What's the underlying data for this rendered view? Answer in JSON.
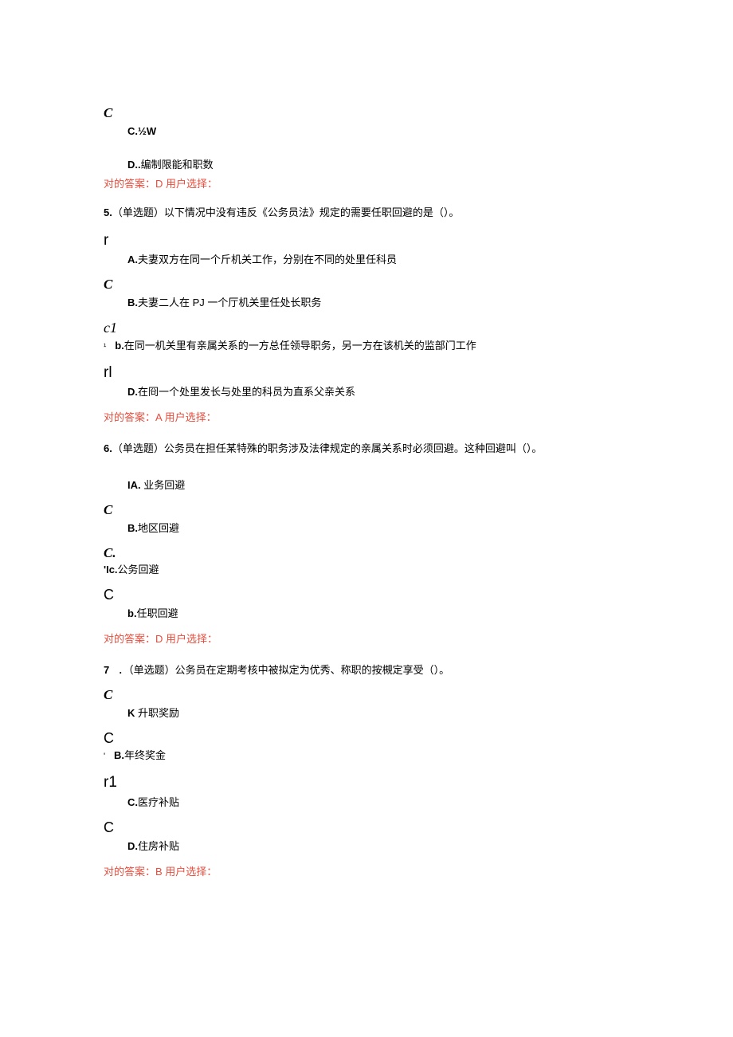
{
  "q4": {
    "markerC": "C",
    "optC_label": "C.",
    "optC_text": "½W",
    "optD_label": "D..",
    "optD_text": "编制限能和职数",
    "answer": "对的答案：D 用户选择："
  },
  "q5": {
    "number": "5.",
    "stem": "（单选题）以下情况中没有违反《公务员法》规定的需要任职回避的是（）。",
    "markerR": "r",
    "optA_label": "A.",
    "optA_text": "夫妻双方在同一个斤机关工作，分别在不同的处里任科员",
    "markerC": "C",
    "optB_label": "B.",
    "optB_text": "夫妻二人在 PJ 一个厅机关里任处长职务",
    "markerC1": "c1",
    "sub1": "¹",
    "optC_label": "b.",
    "optC_text": "在同一机关里有亲属关系的一方总任领导职务，另一方在该机关的监部门工作",
    "markerRl": "rl",
    "optD_label": "D.",
    "optD_text": "在冏一个处里发长与处里的科员为直系父亲关系",
    "answer": "对的答案：A 用户选择："
  },
  "q6": {
    "number": "6.",
    "stem": "（单选题）公务员在担任某特殊的职务涉及法律规定的亲属关系时必须回避。这种回避叫（）。",
    "optA_label": "IA.",
    "optA_text": " 业务回避",
    "markerC1": "C",
    "optB_label": "B.",
    "optB_text": "地区回避",
    "markerC2": "C.",
    "optC_label": "'Ic.",
    "optC_text": "公务回避",
    "markerC3": "C",
    "optD_label": "b.",
    "optD_text": "任职回避",
    "answer": "对的答案：D 用户选择："
  },
  "q7": {
    "number": "7",
    "stem": "．（单选题）公务员在定期考核中被拟定为优秀、称职的按槻定享受（）。",
    "markerC1": "C",
    "optA_label": "K",
    "optA_text": " 升职奖励",
    "markerC2": "C",
    "sub2": "'",
    "optB_label": "B.",
    "optB_text": "年终奖金",
    "markerR1": "r1",
    "optC_label": "C.",
    "optC_text": "医疗补贴",
    "markerC3": "C",
    "optD_label": "D.",
    "optD_text": "住房补贴",
    "answer": "对的答案：B 用户选择："
  }
}
